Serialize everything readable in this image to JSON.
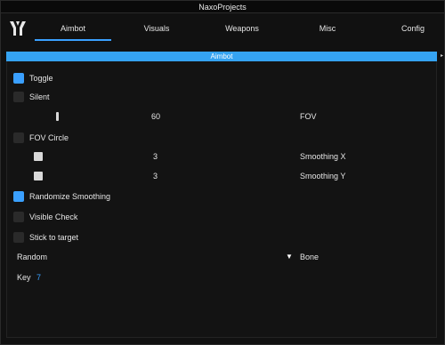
{
  "window": {
    "title": "NaxoProjects"
  },
  "tabs": [
    {
      "label": "Aimbot",
      "active": true
    },
    {
      "label": "Visuals",
      "active": false
    },
    {
      "label": "Weapons",
      "active": false
    },
    {
      "label": "Misc",
      "active": false
    },
    {
      "label": "Config",
      "active": false
    }
  ],
  "section": {
    "title": "Aimbot"
  },
  "options": {
    "toggle": {
      "label": "Toggle",
      "checked": true
    },
    "silent": {
      "label": "Silent",
      "checked": false
    },
    "fov_slider": {
      "value": "60",
      "label": "FOV"
    },
    "fov_circle": {
      "label": "FOV Circle",
      "checked": false
    },
    "smoothing_x": {
      "value": "3",
      "label": "Smoothing X"
    },
    "smoothing_y": {
      "value": "3",
      "label": "Smoothing Y"
    },
    "randomize_smoothing": {
      "label": "Randomize Smoothing",
      "checked": true
    },
    "visible_check": {
      "label": "Visible Check",
      "checked": false
    },
    "stick_to_target": {
      "label": "Stick to target",
      "checked": false
    },
    "bone_combo": {
      "value": "Random",
      "label": "Bone"
    },
    "key": {
      "label": "Key",
      "value": "7"
    }
  },
  "colors": {
    "accent": "#3aa0ff",
    "header": "#35a3f2",
    "background": "#111111"
  }
}
